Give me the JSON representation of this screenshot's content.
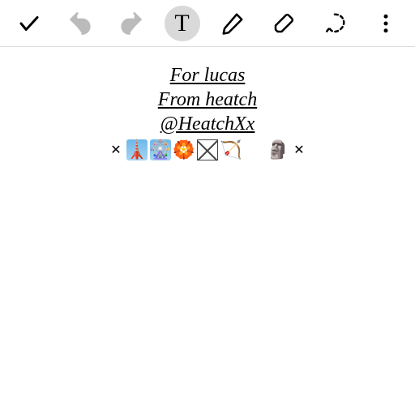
{
  "toolbar": {
    "done_icon": "check",
    "undo_icon": "undo",
    "redo_icon": "redo",
    "text_label": "T",
    "pen_icon": "pen",
    "eraser_icon": "eraser",
    "lasso_icon": "lasso",
    "more_icon": "more-vertical",
    "active_tool": "text"
  },
  "note": {
    "line1": "For lucas",
    "line2": "From heatch",
    "line3": "@HeatchXx"
  },
  "emoji_row": {
    "left_x": "✕",
    "right_x": "✕",
    "items": [
      "🗼",
      "🎡",
      "🏵️",
      "missing",
      "🏹",
      "blank",
      "🗿"
    ]
  }
}
